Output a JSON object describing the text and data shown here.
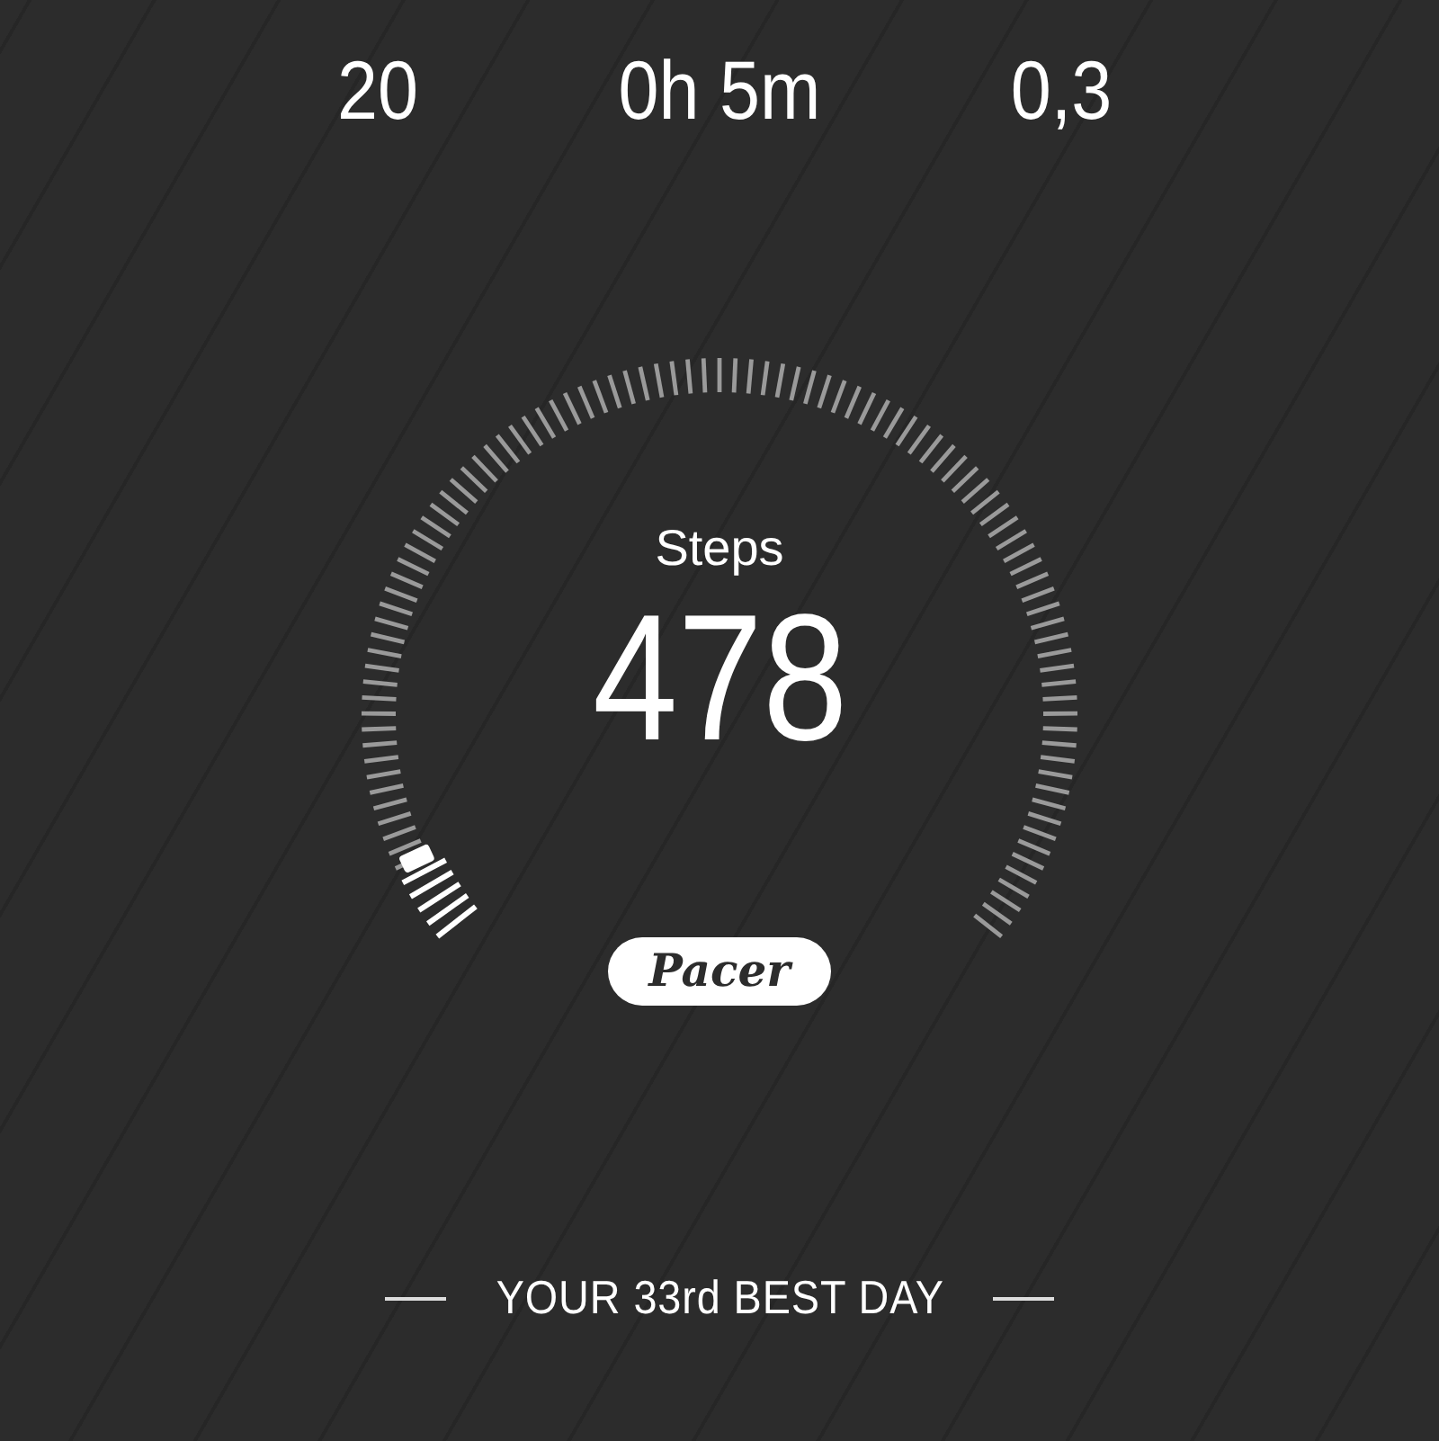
{
  "stats": [
    {
      "value": "20"
    },
    {
      "value": "0h 5m"
    },
    {
      "value": "0,3"
    }
  ],
  "steps": {
    "label": "Steps",
    "value": "478"
  },
  "logo": "Pacer",
  "best_day": {
    "text": "YOUR 33rd BEST DAY"
  }
}
